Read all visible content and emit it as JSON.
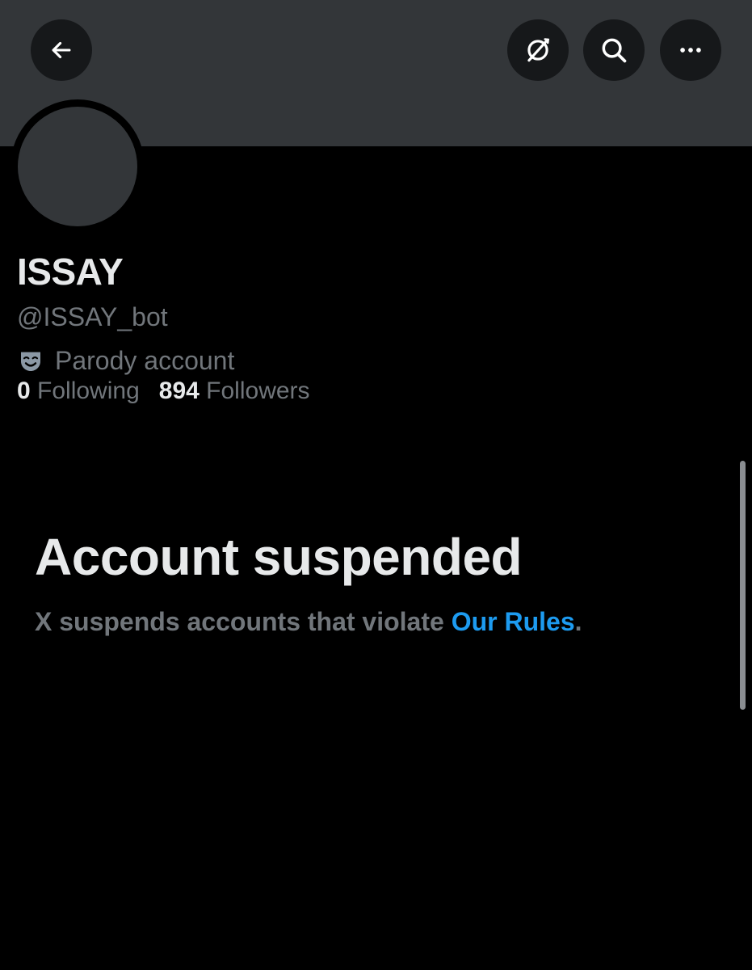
{
  "profile": {
    "display_name": "ISSAY",
    "handle": "@ISSAY_bot",
    "label": "Parody account",
    "label_icon": "parody-mask-icon",
    "following_count": "0",
    "following_label": "Following",
    "followers_count": "894",
    "followers_label": "Followers"
  },
  "header": {
    "icons": [
      "back-arrow-icon",
      "grok-icon",
      "search-icon",
      "more-icon"
    ]
  },
  "suspension": {
    "title": "Account suspended",
    "message_prefix": "X suspends accounts that violate ",
    "link_text": "Our Rules",
    "message_suffix": "."
  },
  "colors": {
    "background": "#000000",
    "banner": "#333639",
    "primary_text": "#e7e9ea",
    "secondary_text": "#71767b",
    "link": "#1d9bf0"
  }
}
